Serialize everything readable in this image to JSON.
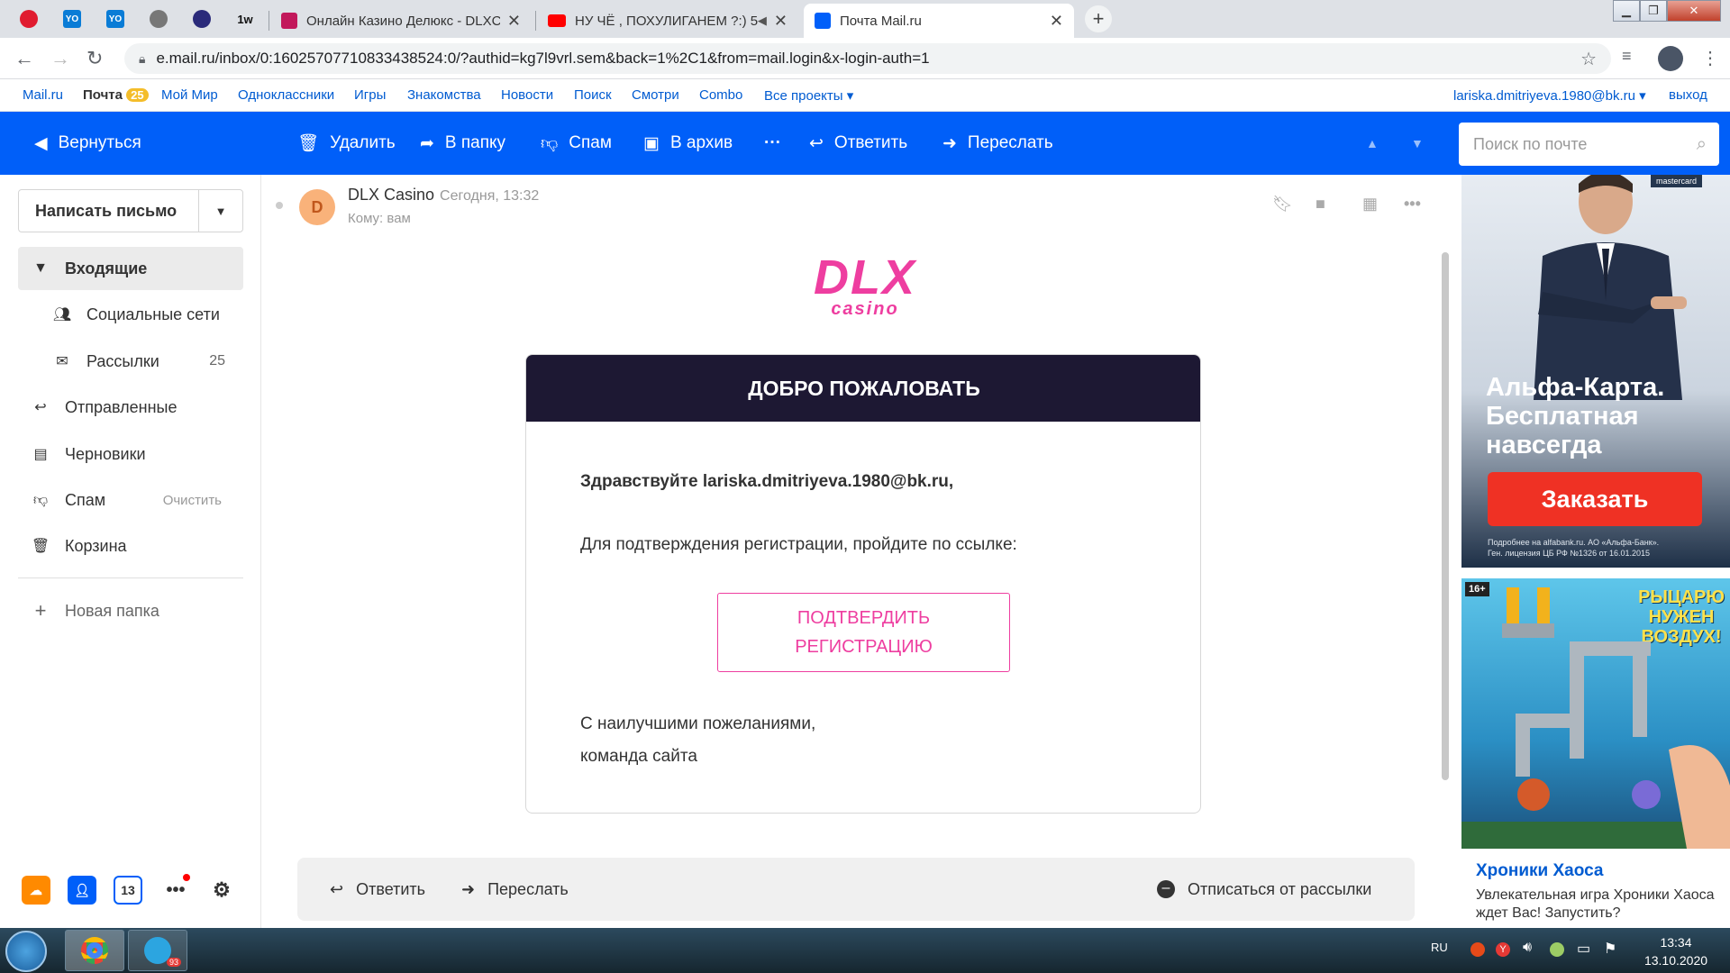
{
  "browser": {
    "tabs": [
      {
        "title": "Онлайн Казино Делюкс - DLXC/",
        "close": "✕"
      },
      {
        "title": "НУ ЧЁ , ПОХУЛИГАНЕМ ?:) 5",
        "close": "✕"
      },
      {
        "title": "Почта Mail.ru",
        "close": "✕"
      }
    ],
    "pinned_icons": [
      "opera-icon",
      "yo-icon",
      "yo-icon",
      "globe-icon",
      "shield-icon",
      "1w-icon"
    ],
    "pinned_labels": [
      "",
      "YO",
      "YO",
      "",
      "",
      "1w"
    ],
    "new_tab": "+",
    "url": "e.mail.ru/inbox/0:16025707710833438524:0/?authid=kg7l9vrl.sem&back=1%2C1&from=mail.login&x-login-auth=1"
  },
  "portal": {
    "links": [
      "Mail.ru",
      "Почта",
      "Мой Мир",
      "Одноклассники",
      "Игры",
      "Знакомства",
      "Новости",
      "Поиск",
      "Смотри",
      "Combo",
      "Все проекты ▾"
    ],
    "mail_badge": "25",
    "user": "lariska.dmitriyeva.1980@bk.ru ▾",
    "logout": "выход"
  },
  "toolbar": {
    "back": "Вернуться",
    "delete": "Удалить",
    "to_folder": "В папку",
    "spam": "Спам",
    "archive": "В архив",
    "more": "···",
    "reply": "Ответить",
    "forward": "Переслать",
    "search_placeholder": "Поиск по почте"
  },
  "sidebar": {
    "compose": "Написать письмо",
    "folders": [
      {
        "label": "Входящие",
        "icon": "triangle-down-icon",
        "count": ""
      },
      {
        "label": "Социальные сети",
        "icon": "people-icon",
        "count": ""
      },
      {
        "label": "Рассылки",
        "icon": "newsletter-icon",
        "count": "25"
      },
      {
        "label": "Отправленные",
        "icon": "sent-icon",
        "count": ""
      },
      {
        "label": "Черновики",
        "icon": "draft-icon",
        "count": ""
      },
      {
        "label": "Спам",
        "icon": "spam-icon",
        "count": ""
      },
      {
        "label": "Корзина",
        "icon": "trash-icon",
        "count": ""
      }
    ],
    "spam_clear": "Очистить",
    "new_folder": "Новая папка",
    "calendar_day": "13"
  },
  "message": {
    "avatar_letter": "D",
    "from": "DLX Casino",
    "date": "Сегодня, 13:32",
    "to": "Кому: вам",
    "logo_main": "DLX",
    "logo_sub": "casino",
    "header": "ДОБРО ПОЖАЛОВАТЬ",
    "greeting": "Здравствуйте lariska.dmitriyeva.1980@bk.ru,",
    "instruction": "Для подтверждения регистрации, пройдите по ссылке:",
    "confirm_button": "ПОДТВЕРДИТЬ РЕГИСТРАЦИЮ",
    "regards_line1": "С наилучшими пожеланиями,",
    "regards_line2": "команда сайта"
  },
  "footer_actions": {
    "reply": "Ответить",
    "forward": "Переслать",
    "unsubscribe": "Отписаться от рассылки"
  },
  "ads": {
    "ad1_brand": "mastercard",
    "ad1_text_line1": "Альфа-Карта.",
    "ad1_text_line2": "Бесплатная",
    "ad1_text_line3": "навсегда",
    "ad1_button": "Заказать",
    "ad1_fine1": "Подробнее на alfabank.ru. АО «Альфа-Банк».",
    "ad1_fine2": "Ген. лицензия ЦБ РФ №1326 от 16.01.2015",
    "ad2_age": "16+",
    "ad2_game_line1": "РЫЦАРЮ",
    "ad2_game_line2": "НУЖЕН",
    "ad2_game_line3": "ВОЗДУХ!",
    "ad2_title": "Хроники Хаоса",
    "ad2_desc": "Увлекательная игра Хроники Хаоса ждет Вас! Запустить?"
  },
  "taskbar": {
    "lang": "RU",
    "time": "13:34",
    "date": "13.10.2020",
    "telegram_badge": "93"
  },
  "colors": {
    "accent_blue": "#005ff9",
    "brand_pink": "#ee3ea0",
    "header_dark": "#1d1833"
  }
}
